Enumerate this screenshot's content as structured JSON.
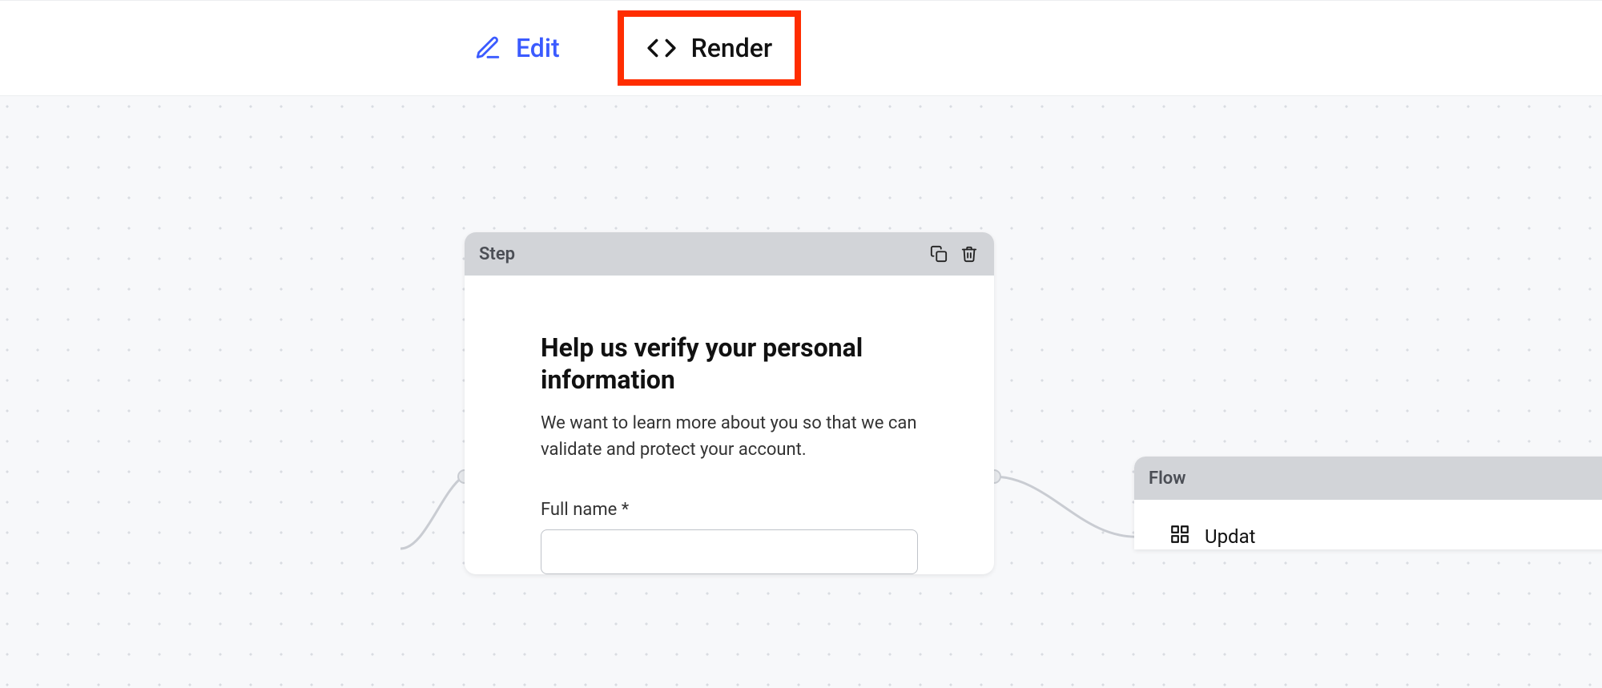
{
  "toolbar": {
    "edit_label": "Edit",
    "render_label": "Render"
  },
  "step": {
    "header_label": "Step",
    "title": "Help us verify your personal information",
    "description": "We want to learn more about you so that we can validate and protect your account.",
    "field_label": "Full name *"
  },
  "flow": {
    "header_label": "Flow",
    "item_label": "Updat"
  }
}
